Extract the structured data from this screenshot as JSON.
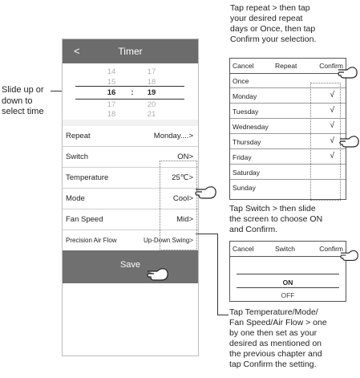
{
  "timer": {
    "back_label": "<",
    "title": "Timer",
    "picker": {
      "rows": [
        {
          "hour": "14",
          "minute": "17"
        },
        {
          "hour": "15",
          "minute": "18"
        },
        {
          "hour": "16",
          "minute": "19"
        },
        {
          "hour": "17",
          "minute": "20"
        },
        {
          "hour": "18",
          "minute": "21"
        }
      ],
      "separator": ":"
    },
    "settings": [
      {
        "label": "Repeat",
        "value": "Monday....>"
      },
      {
        "label": "Switch",
        "value": "ON>"
      },
      {
        "label": "Temperature",
        "value": "25℃>"
      },
      {
        "label": "Mode",
        "value": "Cool>"
      },
      {
        "label": "Fan Speed",
        "value": "Mid>"
      },
      {
        "label": "Precision Air Flow",
        "value": "Up-Down Swing>"
      }
    ],
    "save_label": "Save"
  },
  "repeat_dialog": {
    "cancel": "Cancel",
    "title": "Repeat",
    "confirm": "Confirm",
    "days": [
      {
        "name": "Once",
        "checked": ""
      },
      {
        "name": "Monday",
        "checked": "√"
      },
      {
        "name": "Tuesday",
        "checked": "√"
      },
      {
        "name": "Wednesday",
        "checked": "√"
      },
      {
        "name": "Thursday",
        "checked": "√"
      },
      {
        "name": "Friday",
        "checked": "√"
      },
      {
        "name": "Saturday",
        "checked": ""
      },
      {
        "name": "Sunday",
        "checked": ""
      }
    ]
  },
  "switch_dialog": {
    "cancel": "Cancel",
    "title": "Switch",
    "confirm": "Confirm",
    "options": [
      "ON",
      "OFF"
    ]
  },
  "captions": {
    "slide": [
      "Slide up or",
      "down to",
      "select time"
    ],
    "repeat": [
      "Tap repeat > then tap",
      "your desired repeat",
      "days or Once, then tap",
      "Confirm your selection."
    ],
    "switch": [
      "Tap Switch > then slide",
      "the screen to choose ON",
      "and Confirm."
    ],
    "temperature": [
      "Tap Temperature/Mode/",
      "Fan Speed/Air Flow > one",
      "by one then set as your",
      "desired as mentioned on",
      "the previous chapter and",
      "tap Confirm the setting."
    ]
  }
}
